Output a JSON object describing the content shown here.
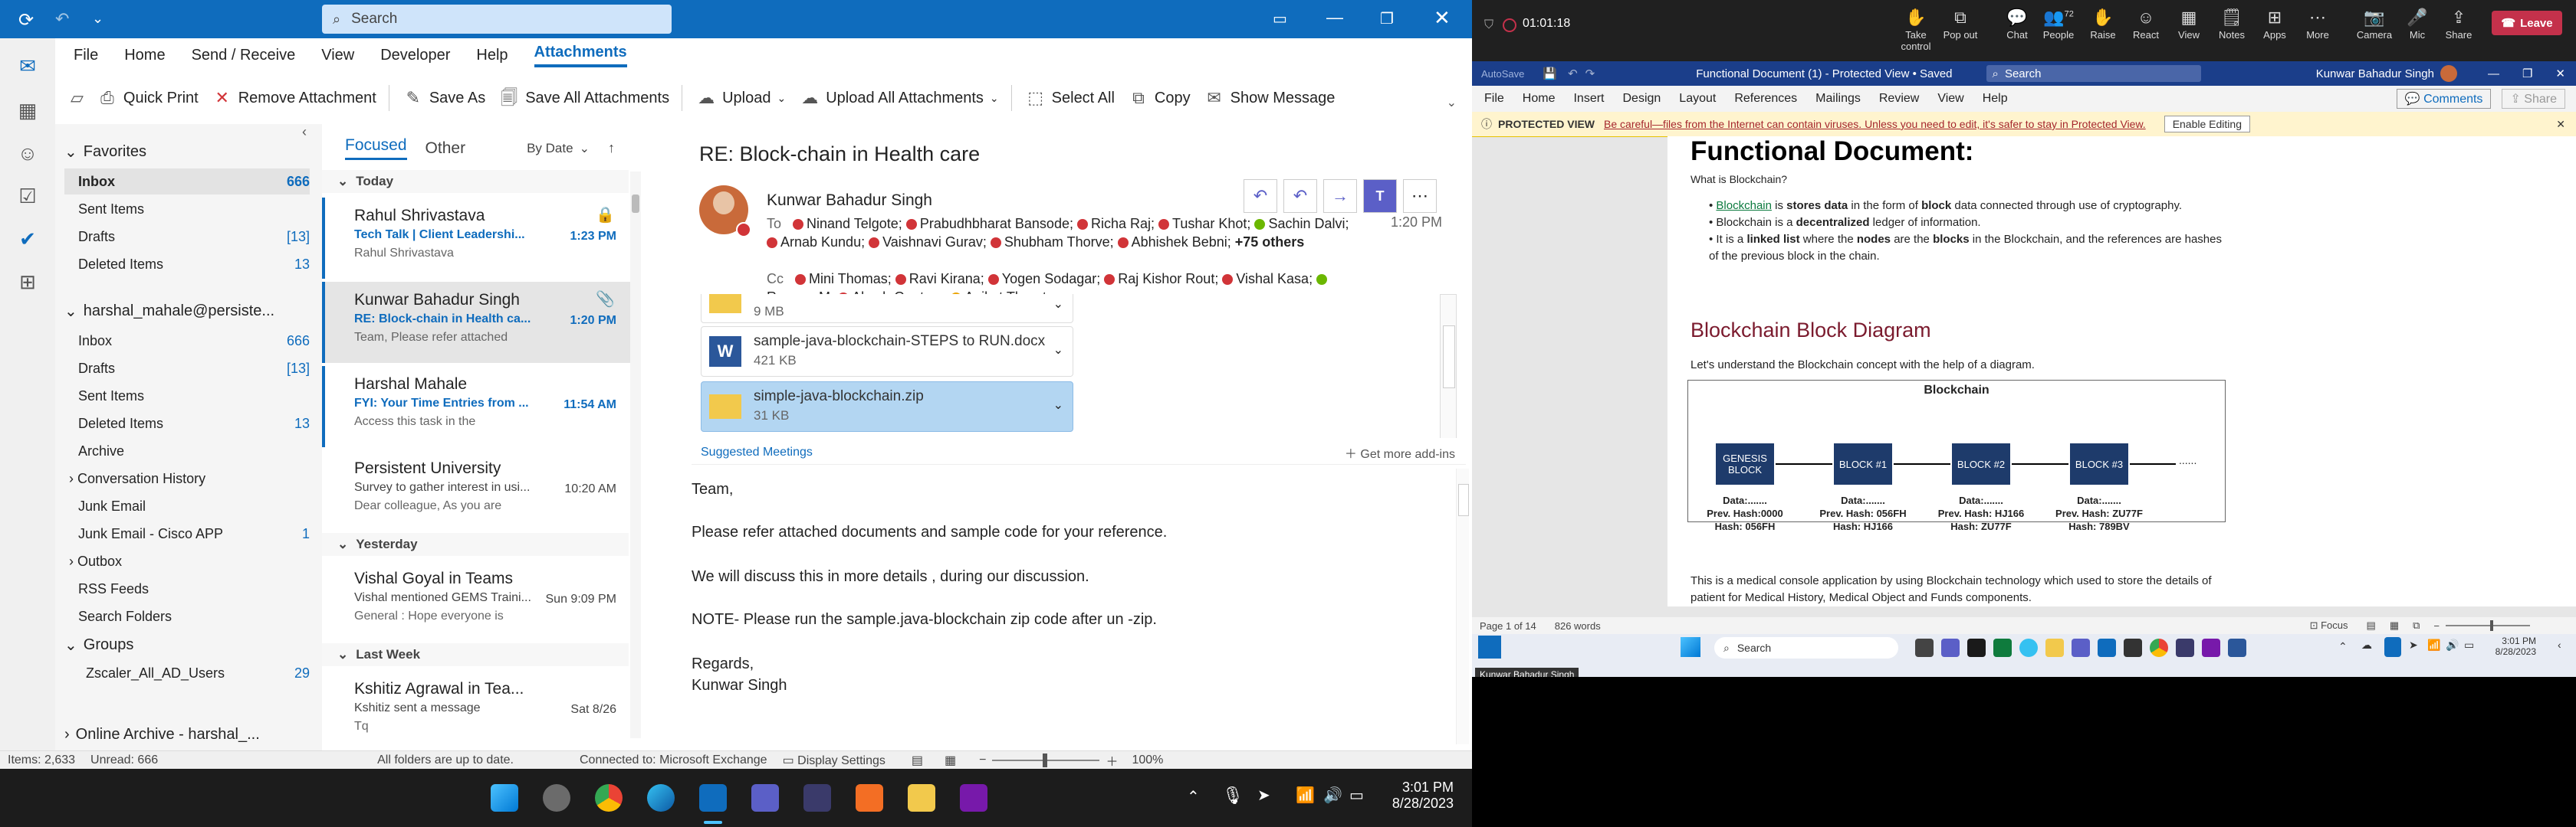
{
  "outlook": {
    "search_placeholder": "Search",
    "menu": [
      "File",
      "Home",
      "Send / Receive",
      "View",
      "Developer",
      "Help",
      "Attachments"
    ],
    "ribbon": [
      "Quick Print",
      "Remove Attachment",
      "Save As",
      "Save All Attachments",
      "Upload",
      "Upload All Attachments",
      "Select All",
      "Copy",
      "Show Message"
    ],
    "favorites": {
      "title": "Favorites",
      "items": [
        {
          "label": "Inbox",
          "count": "666"
        },
        {
          "label": "Sent Items",
          "count": ""
        },
        {
          "label": "Drafts",
          "count": "[13]"
        },
        {
          "label": "Deleted Items",
          "count": "13"
        }
      ]
    },
    "account": {
      "title": "harshal_mahale@persiste...",
      "items": [
        {
          "label": "Inbox",
          "count": "666"
        },
        {
          "label": "Drafts",
          "count": "[13]"
        },
        {
          "label": "Sent Items",
          "count": ""
        },
        {
          "label": "Deleted Items",
          "count": "13"
        },
        {
          "label": "Archive",
          "count": ""
        },
        {
          "label": "Conversation History",
          "count": ""
        },
        {
          "label": "Junk Email",
          "count": ""
        },
        {
          "label": "Junk Email - Cisco APP",
          "count": "1"
        },
        {
          "label": "Outbox",
          "count": ""
        },
        {
          "label": "RSS Feeds",
          "count": ""
        },
        {
          "label": "Search Folders",
          "count": ""
        }
      ]
    },
    "groups": {
      "title": "Groups",
      "items": [
        {
          "label": "Zscaler_All_AD_Users",
          "count": "29"
        }
      ]
    },
    "online_archive": "Online Archive - harshal_...",
    "list_tabs": {
      "focused": "Focused",
      "other": "Other",
      "sort": "By Date"
    },
    "groups_headers": {
      "today": "Today",
      "yesterday": "Yesterday",
      "last_week": "Last Week"
    },
    "messages": [
      {
        "from": "Rahul Shrivastava",
        "subject": "Tech Talk | Client Leadershi...",
        "preview": "Rahul Shrivastava",
        "time": "1:23 PM"
      },
      {
        "from": "Kunwar Bahadur Singh",
        "subject": "RE: Block-chain in Health ca...",
        "preview": "Team,  Please refer attached",
        "time": "1:20 PM"
      },
      {
        "from": "Harshal Mahale",
        "subject": "FYI: Your Time Entries from ...",
        "preview": "Access this task in the",
        "time": "11:54 AM"
      },
      {
        "from": "Persistent University",
        "subject": "Survey to gather interest in usi...",
        "preview": "Dear colleague,  As you are",
        "time": "10:20 AM"
      },
      {
        "from": "Vishal Goyal in Teams",
        "subject": "Vishal mentioned GEMS Traini...",
        "preview": "General : Hope everyone is",
        "time": "Sun 9:09 PM"
      },
      {
        "from": "Kshitiz Agrawal in Tea...",
        "subject": "Kshitiz sent a message",
        "preview": "Tq",
        "time": "Sat 8/26"
      }
    ],
    "reading": {
      "subject": "RE: Block-chain in Health care",
      "sender": "Kunwar Bahadur Singh",
      "to_label": "To",
      "to": [
        "Ninand Telgote;",
        "Prabudhbharat Bansode;",
        "Richa Raj;",
        "Tushar Khot;",
        "Sachin Dalvi;",
        "Arnab Kundu;",
        "Vaishnavi Gurav;",
        "Shubham Thorve;",
        "Abhishek Bebni;"
      ],
      "more": "+75 others",
      "cc_label": "Cc",
      "cc": [
        "Mini Thomas;",
        "Ravi Kirana;",
        "Yogen Sodagar;",
        "Raj Kishor Rout;",
        "Vishal Kasa;",
        "Roopan M;",
        "Akash Gautam;",
        "Aniket Thorat"
      ],
      "time": "1:20 PM",
      "attachments": [
        {
          "name": "",
          "size": "9 MB"
        },
        {
          "name": "sample-java-blockchain-STEPS to RUN.docx",
          "size": "421 KB"
        },
        {
          "name": "simple-java-blockchain.zip",
          "size": "31 KB"
        }
      ],
      "suggested": "Suggested Meetings",
      "addins": "Get more add-ins",
      "body": [
        "Team,",
        "Please refer attached documents and sample code for your reference.",
        "We will discuss this in more details , during our discussion.",
        "NOTE- Please run the sample.java-blockchain zip code after un -zip.",
        "Regards,",
        "Kunwar Singh"
      ]
    },
    "status": {
      "items": "Items: 2,633",
      "unread": "Unread: 666",
      "sync": "All folders are up to date.",
      "conn": "Connected to: Microsoft Exchange",
      "display": "Display Settings",
      "zoom": "100%"
    }
  },
  "taskbar": {
    "time": "3:01 PM",
    "date": "8/28/2023"
  },
  "teams": {
    "timer": "01:01:18",
    "buttons": [
      "Take control",
      "Pop out",
      "Chat",
      "People",
      "Raise",
      "React",
      "View",
      "Notes",
      "Apps",
      "More",
      "Camera",
      "Mic",
      "Share"
    ],
    "people_count": "72",
    "leave": "Leave"
  },
  "word": {
    "autosave": "AutoSave",
    "title": "Functional Document (1) - Protected View • Saved",
    "search": "Search",
    "user": "Kunwar Bahadur Singh",
    "menu": [
      "File",
      "Home",
      "Insert",
      "Design",
      "Layout",
      "References",
      "Mailings",
      "Review",
      "View",
      "Help"
    ],
    "comments": "Comments",
    "share": "Share",
    "protected_label": "PROTECTED VIEW",
    "protected_msg": "Be careful—files from the Internet can contain viruses. Unless you need to edit, it's safer to stay in Protected View.",
    "enable": "Enable Editing",
    "doc": {
      "heading": "Functional Document:",
      "q": "What is Blockchain?",
      "bullets": [
        "Blockchain is stores data in the form of block data connected through use of cryptography.",
        "Blockchain is a decentralized ledger of information.",
        "It is a linked list where the nodes are the blocks in the Blockchain, and the references are hashes of the previous block in the chain."
      ],
      "diagram_title": "Blockchain Block Diagram",
      "diagram_intro": "Let's understand the Blockchain concept with the help of a diagram.",
      "diagram_header": "Blockchain",
      "blocks": [
        {
          "name": "GENESIS BLOCK",
          "l1": "Data:.......",
          "l2": "Prev. Hash:0000",
          "l3": "Hash: 056FH"
        },
        {
          "name": "BLOCK #1",
          "l1": "Data:.......",
          "l2": "Prev. Hash: 056FH",
          "l3": "Hash: HJ166"
        },
        {
          "name": "BLOCK #2",
          "l1": "Data:.......",
          "l2": "Prev. Hash: HJ166",
          "l3": "Hash: ZU77F"
        },
        {
          "name": "BLOCK #3",
          "l1": "Data:.......",
          "l2": "Prev. Hash: ZU77F",
          "l3": "Hash: 789BV"
        }
      ],
      "ellipsis": "......",
      "para": "This is a medical console application by using Blockchain technology which used to store the details of patient for Medical History, Medical Object and Funds components."
    },
    "status": {
      "page": "Page 1 of 14",
      "words": "826 words",
      "focus": "Focus"
    },
    "taskbar": {
      "search": "Search",
      "time": "3:01 PM",
      "date": "8/28/2023",
      "tooltip": "Kunwar Bahadur Singh"
    }
  }
}
